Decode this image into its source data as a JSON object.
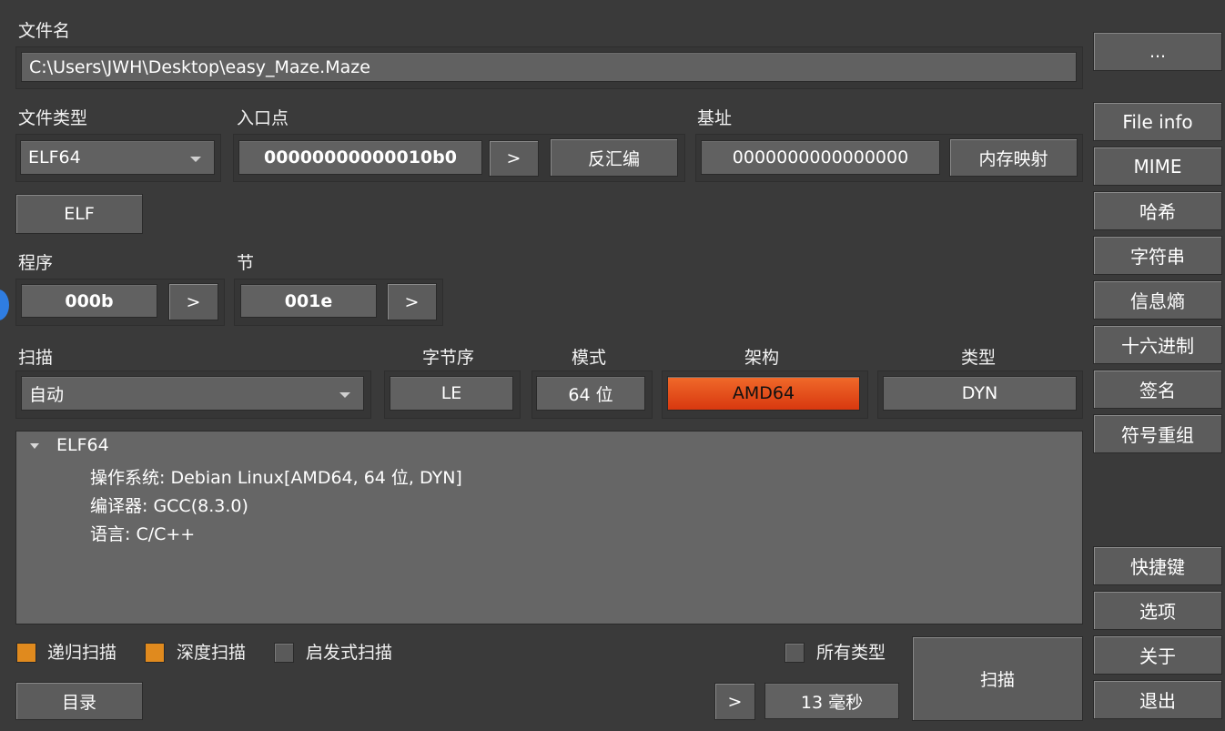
{
  "file": {
    "label": "文件名",
    "path": "C:\\Users\\JWH\\Desktop\\easy_Maze.Maze",
    "browse_label": "..."
  },
  "file_type": {
    "label": "文件类型",
    "value": "ELF64"
  },
  "entry_point": {
    "label": "入口点",
    "value": "00000000000010b0",
    "go_label": ">",
    "disasm_label": "反汇编"
  },
  "base_address": {
    "label": "基址",
    "value": "0000000000000000",
    "memmap_label": "内存映射"
  },
  "elf_button": "ELF",
  "program": {
    "label": "程序",
    "value": "000b",
    "go_label": ">"
  },
  "section": {
    "label": "节",
    "value": "001e",
    "go_label": ">"
  },
  "scan": {
    "label": "扫描",
    "value": "自动"
  },
  "endianness": {
    "label": "字节序",
    "value": "LE"
  },
  "mode": {
    "label": "模式",
    "value": "64 位"
  },
  "arch": {
    "label": "架构",
    "value": "AMD64",
    "color": "#e8461a"
  },
  "type": {
    "label": "类型",
    "value": "DYN"
  },
  "result": {
    "root": "ELF64",
    "lines": [
      "操作系统: Debian Linux[AMD64, 64 位, DYN]",
      "编译器: GCC(8.3.0)",
      "语言: C/C++"
    ]
  },
  "options": {
    "recursive": {
      "label": "递归扫描",
      "checked": true
    },
    "deep": {
      "label": "深度扫描",
      "checked": true
    },
    "heuristic": {
      "label": "启发式扫描",
      "checked": false
    },
    "all_types": {
      "label": "所有类型",
      "checked": false
    }
  },
  "directory_label": "目录",
  "time_go_label": ">",
  "time_value": "13 毫秒",
  "scan_button": "扫描",
  "sidebar": {
    "top": [
      "File info",
      "MIME",
      "哈希",
      "字符串",
      "信息熵",
      "十六进制",
      "签名",
      "符号重组"
    ],
    "bottom": [
      "快捷键",
      "选项",
      "关于",
      "退出"
    ]
  },
  "colors": {
    "accent_check": "#e08a1e",
    "background": "#3a3a3a"
  }
}
